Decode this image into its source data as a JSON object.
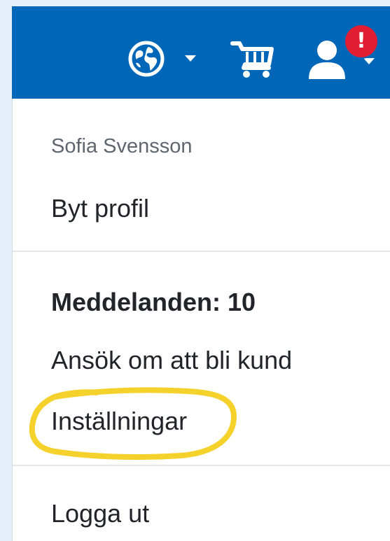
{
  "topbar": {
    "background": "#0067b8",
    "icons": [
      "globe-icon",
      "chevron-down-icon",
      "cart-icon",
      "user-icon",
      "chevron-down-icon"
    ],
    "alert_badge": "!",
    "alert_color": "#e11d32"
  },
  "menu": {
    "header": "Sofia Svensson",
    "switch_profile": "Byt profil",
    "messages": "Meddelanden: 10",
    "apply_customer": "Ansök om att bli kund",
    "settings": "Inställningar",
    "logout": "Logga ut"
  },
  "annotation": {
    "highlight_color": "#f5d22b",
    "highlighted_item": "Inställningar"
  }
}
